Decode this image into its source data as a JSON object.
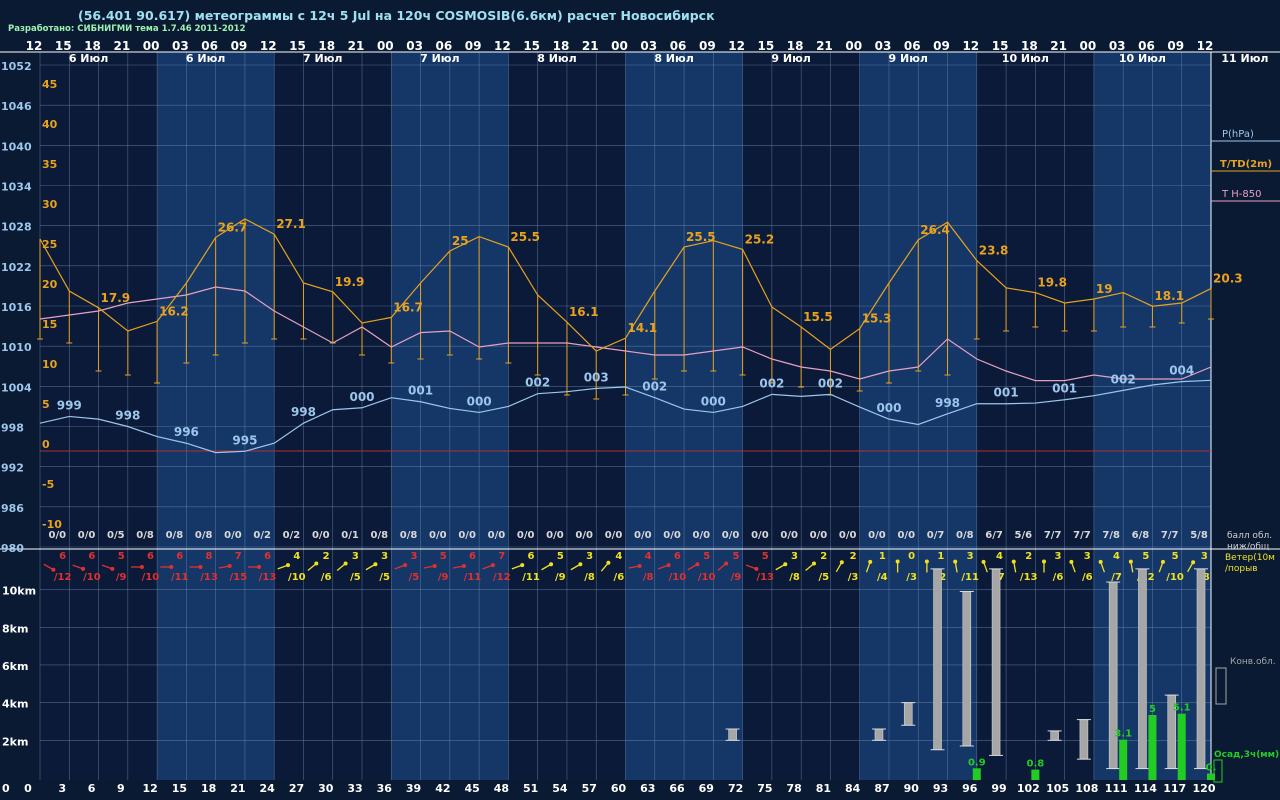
{
  "header": {
    "title": "(56.401 90.617) метеограммы с  12ч 5 Jul на 120ч COSMOSIB(6.6км) расчет Новосибирск",
    "developer": "Разработано: СИБНИГМИ тема 1.7.46 2011-2012"
  },
  "colors": {
    "background": "#0b1a33",
    "band_dark": "#0a1a38",
    "band_light": "#143768",
    "grid": "#6d87ad",
    "temperature": "#e8a21e",
    "pressure": "#9cc6ec",
    "t850": "#e8a0c0",
    "zero_line": "#b03030",
    "cloud": "#a6a6a6",
    "precip": "#22cc22",
    "wind_red": "#e03030",
    "wind_yellow": "#f0e020",
    "white": "#ffffff"
  },
  "chart_data": {
    "type": "line",
    "time_axis": {
      "hour_labels": [
        "12",
        "15",
        "18",
        "21",
        "00",
        "03",
        "06",
        "09",
        "12",
        "15",
        "18",
        "21",
        "00",
        "03",
        "06",
        "09",
        "12",
        "15",
        "18",
        "21",
        "00",
        "03",
        "06",
        "09",
        "12",
        "15",
        "18",
        "21",
        "00",
        "03",
        "06",
        "09",
        "12",
        "15",
        "18",
        "21",
        "00",
        "03",
        "06",
        "09",
        "12"
      ],
      "lead_hours": [
        "0",
        "3",
        "6",
        "9",
        "12",
        "15",
        "18",
        "21",
        "24",
        "27",
        "30",
        "33",
        "36",
        "39",
        "42",
        "45",
        "48",
        "51",
        "54",
        "57",
        "60",
        "63",
        "66",
        "69",
        "72",
        "75",
        "78",
        "81",
        "84",
        "87",
        "90",
        "93",
        "96",
        "99",
        "102",
        "105",
        "108",
        "111",
        "114",
        "117",
        "120"
      ],
      "date_labels": [
        {
          "label": "6 Июл",
          "at_step": 2
        },
        {
          "label": "6 Июл",
          "at_step": 6
        },
        {
          "label": "7 Июл",
          "at_step": 10
        },
        {
          "label": "7 Июл",
          "at_step": 14
        },
        {
          "label": "8 Июл",
          "at_step": 18
        },
        {
          "label": "8 Июл",
          "at_step": 22
        },
        {
          "label": "9 Июл",
          "at_step": 26
        },
        {
          "label": "9 Июл",
          "at_step": 30
        },
        {
          "label": "10 Июл",
          "at_step": 34
        },
        {
          "label": "10 Июл",
          "at_step": 38
        },
        {
          "label": "11 Июл",
          "at_step": 41.5
        }
      ]
    },
    "pressure_axis": {
      "labels": [
        "1052",
        "1046",
        "1040",
        "1034",
        "1028",
        "1022",
        "1016",
        "1010",
        "1004",
        "998",
        "992",
        "986",
        "980"
      ],
      "range": [
        980,
        1052
      ]
    },
    "temperature_axis": {
      "labels": [
        "45",
        "40",
        "35",
        "30",
        "25",
        "20",
        "15",
        "10",
        "5",
        "0",
        "-5",
        "-10"
      ],
      "range": [
        -12,
        47
      ]
    },
    "series": [
      {
        "name": "T/TD(2m)",
        "key": "temperature",
        "values": [
          26.5,
          20.0,
          17.9,
          15.0,
          16.2,
          21.0,
          26.7,
          29.0,
          27.1,
          21.0,
          19.9,
          16.0,
          16.7,
          21.0,
          25.0,
          26.8,
          25.5,
          19.5,
          16.1,
          12.5,
          14.1,
          20.0,
          25.5,
          26.3,
          25.2,
          18.0,
          15.5,
          12.7,
          15.3,
          21.0,
          26.4,
          28.6,
          23.8,
          20.4,
          19.8,
          18.5,
          19.0,
          19.8,
          18.1,
          18.5,
          20.3
        ],
        "labels": [
          {
            "i": 2,
            "text": "17.9"
          },
          {
            "i": 4,
            "text": "16.2"
          },
          {
            "i": 6,
            "text": "26.7"
          },
          {
            "i": 8,
            "text": "27.1"
          },
          {
            "i": 10,
            "text": "19.9"
          },
          {
            "i": 12,
            "text": "16.7"
          },
          {
            "i": 14,
            "text": "25"
          },
          {
            "i": 16,
            "text": "25.5"
          },
          {
            "i": 18,
            "text": "16.1"
          },
          {
            "i": 20,
            "text": "14.1"
          },
          {
            "i": 22,
            "text": "25.5"
          },
          {
            "i": 24,
            "text": "25.2"
          },
          {
            "i": 26,
            "text": "15.5"
          },
          {
            "i": 28,
            "text": "15.3"
          },
          {
            "i": 30,
            "text": "26.4"
          },
          {
            "i": 32,
            "text": "23.8"
          },
          {
            "i": 34,
            "text": "19.8"
          },
          {
            "i": 36,
            "text": "19"
          },
          {
            "i": 38,
            "text": "18.1"
          },
          {
            "i": 40,
            "text": "20.3"
          }
        ]
      },
      {
        "name": "TD(2m)",
        "key": "dewpoint",
        "values": [
          14.0,
          13.5,
          10.0,
          9.5,
          8.5,
          11.0,
          12.0,
          13.5,
          14.0,
          14.0,
          13.5,
          12.0,
          11.0,
          11.5,
          12.0,
          11.5,
          11.0,
          9.5,
          7.0,
          6.5,
          7.0,
          9.0,
          10.0,
          10.0,
          9.5,
          8.5,
          8.0,
          7.0,
          7.5,
          8.5,
          10.0,
          9.5,
          14.0,
          15.0,
          15.5,
          15.0,
          15.0,
          15.5,
          15.5,
          16.0,
          16.5
        ]
      },
      {
        "name": "Т Н-850",
        "key": "t850",
        "values": [
          16.5,
          17.0,
          17.5,
          18.5,
          19.0,
          19.5,
          20.5,
          20.0,
          17.5,
          15.5,
          13.5,
          15.5,
          13.0,
          14.8,
          15.0,
          13.0,
          13.5,
          13.5,
          13.5,
          13.0,
          12.5,
          12.0,
          12.0,
          12.5,
          13.0,
          11.5,
          10.5,
          10.0,
          9.0,
          10.0,
          10.5,
          14.0,
          11.5,
          10.0,
          8.8,
          8.8,
          9.5,
          9.0,
          9.0,
          9.0,
          10.5
        ]
      },
      {
        "name": "P(hPa)",
        "key": "pressure",
        "values": [
          998.5,
          999.5,
          999.1,
          998.0,
          996.5,
          995.5,
          994.1,
          994.3,
          995.5,
          998.5,
          1000.5,
          1000.8,
          1002.3,
          1001.7,
          1000.7,
          1000.1,
          1001.0,
          1002.9,
          1003.2,
          1003.7,
          1003.9,
          1002.3,
          1000.6,
          1000.1,
          1001.0,
          1002.8,
          1002.5,
          1002.8,
          1000.9,
          999.1,
          998.3,
          999.9,
          1001.4,
          1001.4,
          1001.5,
          1002.0,
          1002.6,
          1003.4,
          1004.2,
          1004.7,
          1004.9
        ],
        "labels": [
          {
            "i": 1,
            "text": "999"
          },
          {
            "i": 3,
            "text": "998"
          },
          {
            "i": 5,
            "text": "996"
          },
          {
            "i": 7,
            "text": "995"
          },
          {
            "i": 9,
            "text": "998"
          },
          {
            "i": 11,
            "text": "000"
          },
          {
            "i": 13,
            "text": "001"
          },
          {
            "i": 15,
            "text": "000"
          },
          {
            "i": 17,
            "text": "002"
          },
          {
            "i": 19,
            "text": "003"
          },
          {
            "i": 21,
            "text": "002"
          },
          {
            "i": 23,
            "text": "000"
          },
          {
            "i": 25,
            "text": "002"
          },
          {
            "i": 27,
            "text": "002"
          },
          {
            "i": 29,
            "text": "000"
          },
          {
            "i": 31,
            "text": "998"
          },
          {
            "i": 33,
            "text": "001"
          },
          {
            "i": 35,
            "text": "001"
          },
          {
            "i": 37,
            "text": "002"
          },
          {
            "i": 39,
            "text": "004"
          }
        ]
      }
    ],
    "cloud_cover": [
      "0/0",
      "0/0",
      "0/5",
      "0/8",
      "0/8",
      "0/8",
      "0/0",
      "0/2",
      "0/2",
      "0/0",
      "0/1",
      "0/8",
      "0/8",
      "0/0",
      "0/0",
      "0/0",
      "0/0",
      "0/0",
      "0/0",
      "0/0",
      "0/0",
      "0/0",
      "0/0",
      "0/0",
      "0/0",
      "0/0",
      "0/0",
      "0/0",
      "0/0",
      "0/0",
      "0/7",
      "0/8",
      "6/7",
      "5/6",
      "7/7",
      "7/7",
      "7/8",
      "6/8",
      "7/7",
      "5/8"
    ],
    "wind": {
      "speed": [
        "6",
        "6",
        "5",
        "6",
        "6",
        "8",
        "7",
        "6",
        "4",
        "2",
        "3",
        "3",
        "3",
        "5",
        "6",
        "7",
        "6",
        "5",
        "3",
        "4",
        "4",
        "6",
        "5",
        "5",
        "5",
        "3",
        "2",
        "2",
        "1",
        "0",
        "1",
        "3",
        "4",
        "2",
        "3",
        "3",
        "4",
        "5",
        "5",
        "3"
      ],
      "gust": [
        "/12",
        "/10",
        "/9",
        "/10",
        "/11",
        "/13",
        "/15",
        "/13",
        "/10",
        "/6",
        "/5",
        "/5",
        "/5",
        "/9",
        "/11",
        "/12",
        "/11",
        "/9",
        "/8",
        "/6",
        "/8",
        "/10",
        "/10",
        "/9",
        "/13",
        "/8",
        "/5",
        "/3",
        "/4",
        "/3",
        "/2",
        "/11",
        "/7",
        "/13",
        "/6",
        "/6",
        "/7",
        "/12",
        "/10",
        "/8"
      ],
      "color": [
        "red",
        "red",
        "red",
        "red",
        "red",
        "red",
        "red",
        "red",
        "yellow",
        "yellow",
        "yellow",
        "yellow",
        "red",
        "red",
        "red",
        "red",
        "yellow",
        "yellow",
        "yellow",
        "yellow",
        "red",
        "red",
        "red",
        "red",
        "red",
        "yellow",
        "yellow",
        "yellow",
        "yellow",
        "yellow",
        "yellow",
        "yellow",
        "yellow",
        "yellow",
        "yellow",
        "yellow",
        "yellow",
        "yellow",
        "yellow",
        "yellow"
      ],
      "direction_deg": [
        300,
        290,
        290,
        270,
        270,
        270,
        260,
        270,
        250,
        230,
        230,
        240,
        250,
        260,
        260,
        250,
        250,
        240,
        240,
        220,
        260,
        250,
        240,
        230,
        290,
        240,
        230,
        210,
        200,
        180,
        180,
        170,
        160,
        170,
        180,
        160,
        160,
        170,
        200,
        210
      ]
    },
    "height_axis": {
      "labels": [
        "10km",
        "8km",
        "6km",
        "4km",
        "2km"
      ],
      "range_km": [
        0,
        11.3
      ]
    },
    "convective_clouds": [
      {
        "step": 24,
        "base_km": 2.0,
        "top_km": 2.6
      },
      {
        "step": 29,
        "base_km": 2.0,
        "top_km": 2.6
      },
      {
        "step": 30,
        "base_km": 2.8,
        "top_km": 4.0
      },
      {
        "step": 31,
        "base_km": 1.5,
        "top_km": 11.1
      },
      {
        "step": 32,
        "base_km": 1.7,
        "top_km": 9.9
      },
      {
        "step": 33,
        "base_km": 1.2,
        "top_km": 11.1
      },
      {
        "step": 35,
        "base_km": 2.0,
        "top_km": 2.5
      },
      {
        "step": 36,
        "base_km": 1.0,
        "top_km": 3.1
      },
      {
        "step": 37,
        "base_km": 0.5,
        "top_km": 10.4
      },
      {
        "step": 38,
        "base_km": 0.5,
        "top_km": 11.1
      },
      {
        "step": 39,
        "base_km": 0.5,
        "top_km": 4.4
      },
      {
        "step": 40,
        "base_km": 0.5,
        "top_km": 11.1
      }
    ],
    "precipitation": [
      {
        "step": 32,
        "value": 0.9,
        "label": "0.9"
      },
      {
        "step": 34,
        "value": 0.8,
        "label": "0.8"
      },
      {
        "step": 37,
        "value": 3.1,
        "label": "3.1"
      },
      {
        "step": 38,
        "value": 5.0,
        "label": "5"
      },
      {
        "step": 39,
        "value": 5.1,
        "label": "5.1"
      },
      {
        "step": 40,
        "value": 0.5,
        "label": "0."
      }
    ],
    "legend": {
      "pressure": "P(hPa)",
      "temperature": "T/TD(2m)",
      "t850": "Т Н-850",
      "cloud_cover_1": "балл обл.",
      "cloud_cover_2": "ниж/общ",
      "wind_1": "Ветер(10м",
      "wind_2": "/порыв",
      "convective": "Конв.обл.",
      "precip": "Осад,3ч(мм)"
    }
  }
}
